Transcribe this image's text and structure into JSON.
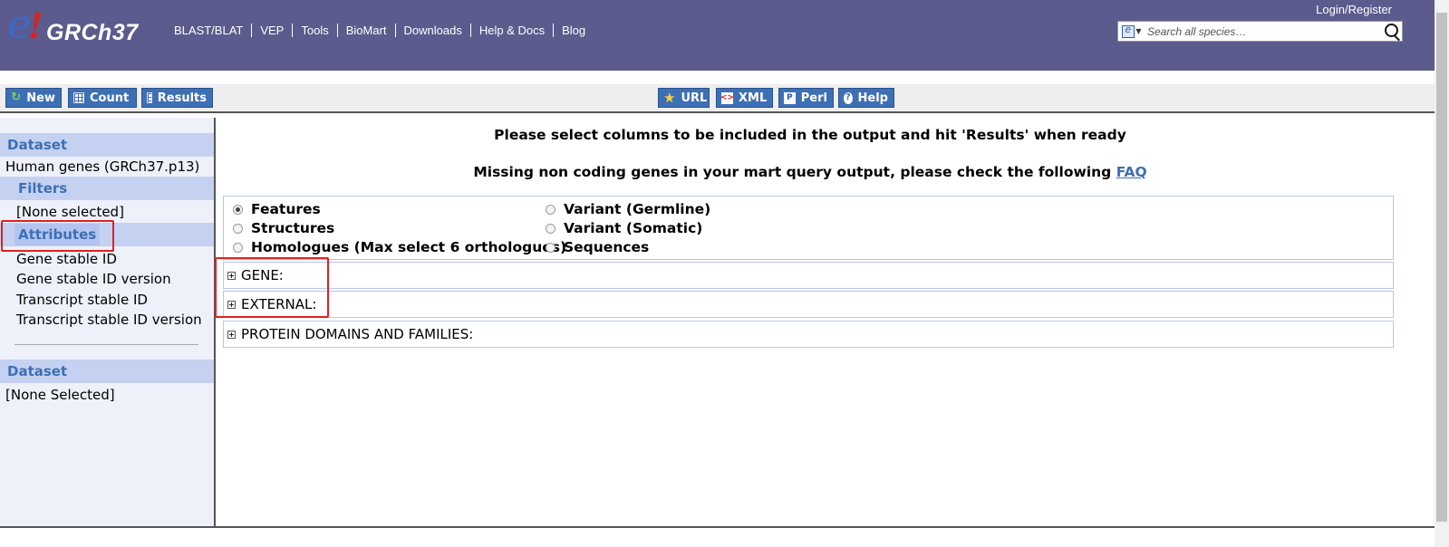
{
  "masthead": {
    "logo_e": "e",
    "logo_bang": "!",
    "logo_text": "GRCh37",
    "nav": [
      "BLAST/BLAT",
      "VEP",
      "Tools",
      "BioMart",
      "Downloads",
      "Help & Docs",
      "Blog"
    ],
    "login_label": "Login/Register",
    "search_placeholder": "Search all species…",
    "brand_color": "#5b5b8d"
  },
  "toolbar": {
    "left_buttons": [
      {
        "label": "New",
        "icon": "refresh-icon"
      },
      {
        "label": "Count",
        "icon": "calculator-icon"
      },
      {
        "label": "Results",
        "icon": "table-icon"
      }
    ],
    "right_buttons": [
      {
        "label": "URL",
        "icon": "star-icon"
      },
      {
        "label": "XML",
        "icon": "xml-icon"
      },
      {
        "label": "Perl",
        "icon": "perl-icon"
      },
      {
        "label": "Help",
        "icon": "help-icon"
      }
    ],
    "button_color": "#3d6fb5"
  },
  "sidebar": {
    "dataset_heading": "Dataset",
    "dataset_value": "Human genes (GRCh37.p13)",
    "filters_heading": "Filters",
    "filters_value": "[None selected]",
    "attributes_heading": "Attributes",
    "attributes": [
      "Gene stable ID",
      "Gene stable ID version",
      "Transcript stable ID",
      "Transcript stable ID version"
    ],
    "dataset2_heading": "Dataset",
    "dataset2_value": "[None Selected]"
  },
  "main": {
    "instruction": "Please select columns to be included in the output and hit 'Results' when ready",
    "missing_notice": "Missing non coding genes in your mart query output, please check the following",
    "faq_link": "FAQ",
    "page_options": [
      {
        "label": "Features",
        "checked": true
      },
      {
        "label": "Structures",
        "checked": false
      },
      {
        "label": "Homologues (Max select 6 orthologues)",
        "checked": false
      },
      {
        "label": "Variant (Germline)",
        "checked": false
      },
      {
        "label": "Variant (Somatic)",
        "checked": false
      },
      {
        "label": "Sequences",
        "checked": false
      }
    ],
    "sections": [
      "GENE:",
      "EXTERNAL:",
      "PROTEIN DOMAINS AND FAMILIES:"
    ]
  },
  "colors": {
    "annotation_red": "#e02020",
    "section_header_bg": "#c5d1f1",
    "link_blue": "#3d6fb5"
  }
}
